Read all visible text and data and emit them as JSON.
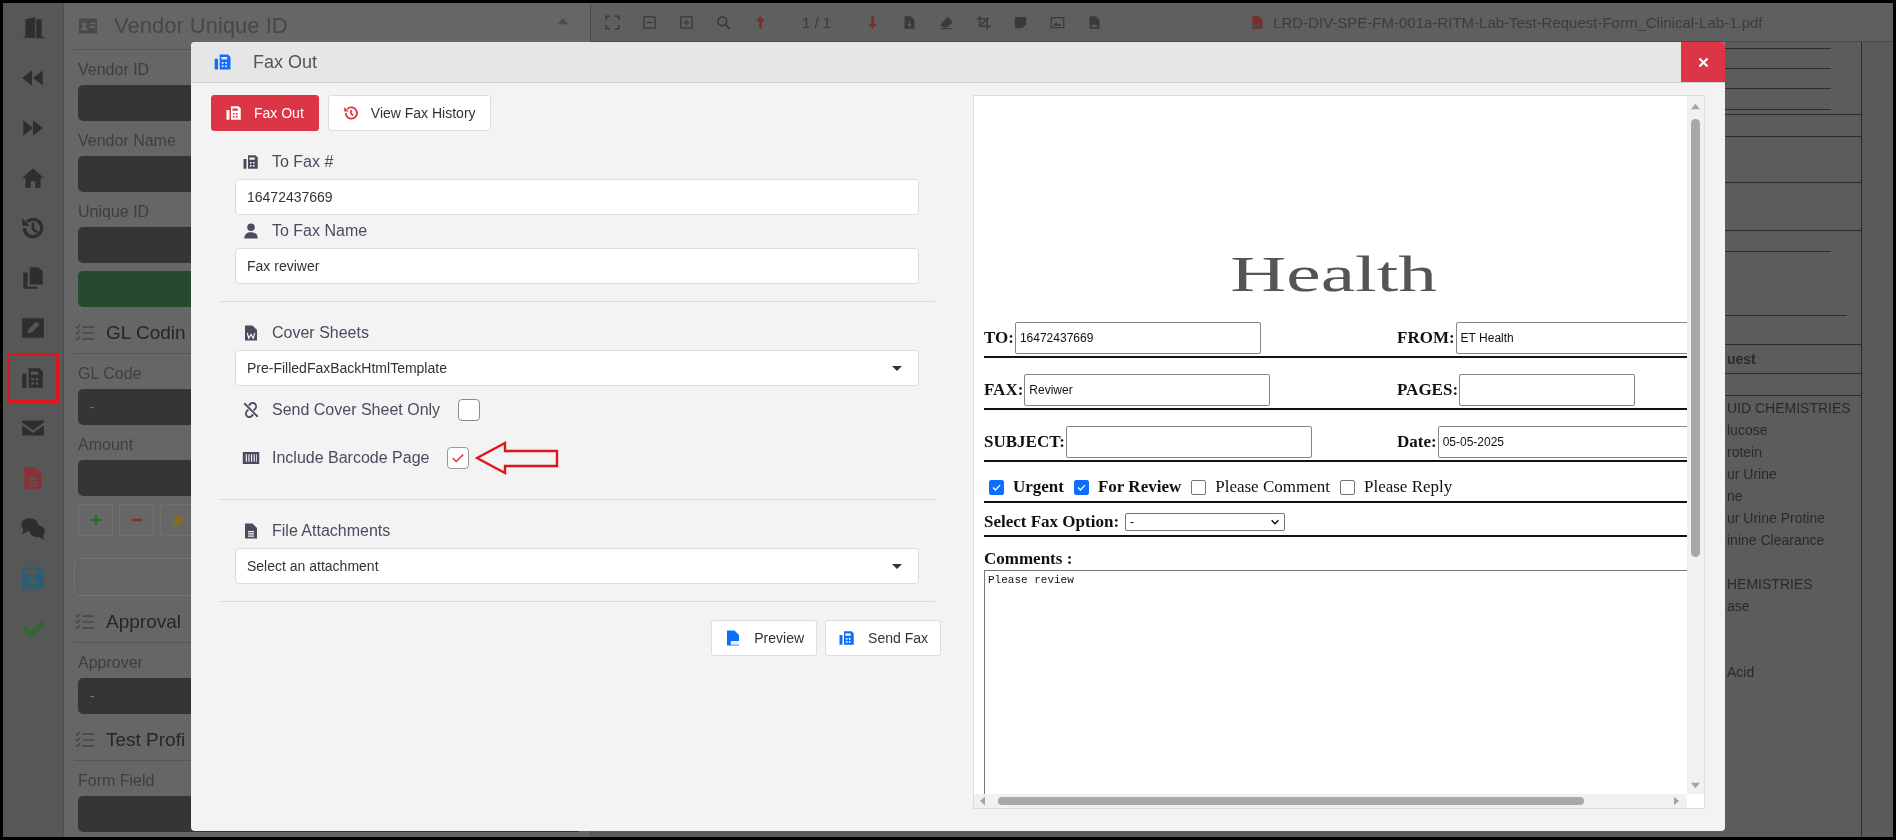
{
  "sidebar": {
    "items": [
      {
        "highlighted": false
      },
      {
        "highlighted": false
      },
      {
        "highlighted": false
      },
      {
        "highlighted": false
      },
      {
        "highlighted": false
      },
      {
        "highlighted": false
      },
      {
        "highlighted": false
      },
      {
        "highlighted": true
      },
      {
        "highlighted": false
      },
      {
        "highlighted": false
      },
      {
        "highlighted": false
      },
      {
        "highlighted": false
      },
      {
        "highlighted": false
      }
    ]
  },
  "form_panel": {
    "title": "Vendor Unique ID",
    "rows": [
      {
        "kind": "label",
        "text": "Vendor ID"
      },
      {
        "kind": "input"
      },
      {
        "kind": "label",
        "text": "Vendor Name"
      },
      {
        "kind": "input"
      },
      {
        "kind": "label",
        "text": "Unique ID"
      },
      {
        "kind": "input"
      },
      {
        "kind": "action"
      },
      {
        "kind": "section",
        "text": "GL Codin"
      },
      {
        "kind": "label",
        "text": "GL Code"
      },
      {
        "kind": "input",
        "value": "-"
      },
      {
        "kind": "label",
        "text": "Amount"
      },
      {
        "kind": "input"
      },
      {
        "kind": "tools"
      },
      {
        "kind": "field"
      },
      {
        "kind": "section",
        "text": "Approval"
      },
      {
        "kind": "label",
        "text": "Approver"
      },
      {
        "kind": "input",
        "value": "-"
      },
      {
        "kind": "section",
        "text": "Test Profi"
      },
      {
        "kind": "label",
        "text": "Form Field"
      },
      {
        "kind": "input"
      }
    ]
  },
  "viewer": {
    "page_indicator": "1 / 1",
    "file_name": "LRD-DIV-SPE-FM-001a-RITM-Lab-Test-Request-Form_Clinical-Lab-1.pdf",
    "document": {
      "heading": "uest",
      "groups": [
        [
          "UID CHEMISTRIES",
          "lucose",
          "rotein",
          "ur Urine",
          "ne",
          "ur Urine Protine",
          "inine Clearance"
        ],
        [
          "HEMISTRIES",
          "ase"
        ],
        [
          "Acid"
        ]
      ]
    }
  },
  "dialog": {
    "title": "Fax Out",
    "tabs": [
      {
        "label": "Fax Out",
        "selected": true
      },
      {
        "label": "View Fax History",
        "selected": false
      }
    ],
    "sections": [
      [
        {
          "kind": "text",
          "label": "To Fax #",
          "value": "16472437669"
        },
        {
          "kind": "text",
          "label": "To Fax Name",
          "value": "Fax reviwer"
        }
      ],
      [
        {
          "kind": "select",
          "label": "Cover Sheets",
          "value": "Pre-FilledFaxBackHtmlTemplate"
        },
        {
          "kind": "checkbox",
          "label": "Send Cover Sheet Only",
          "checked": false,
          "annotated": false
        },
        {
          "kind": "checkbox",
          "label": "Include Barcode Page",
          "checked": true,
          "annotated": true
        }
      ],
      [
        {
          "kind": "select",
          "label": "File Attachments",
          "value": "Select an attachment"
        }
      ]
    ],
    "buttons": [
      {
        "label": "Preview"
      },
      {
        "label": "Send Fax"
      }
    ],
    "preview": {
      "logo": "Health",
      "rows": [
        [
          {
            "label": "TO:",
            "value": "16472437669"
          },
          {
            "label": "FROM:",
            "value": "ET Health"
          }
        ],
        [
          {
            "label": "FAX:",
            "value": "Reviwer"
          },
          {
            "label": "PAGES:"
          }
        ],
        [
          {
            "label": "SUBJECT:"
          },
          {
            "label": "Date:",
            "value": "05-05-2025"
          }
        ]
      ],
      "options": [
        {
          "label": "Urgent",
          "checked": true
        },
        {
          "label": "For Review",
          "checked": true
        },
        {
          "label": "Please Comment",
          "checked": false
        },
        {
          "label": "Please Reply",
          "checked": false
        }
      ],
      "fax_option": {
        "label": "Select Fax Option:",
        "value": "-"
      },
      "comments": {
        "label": "Comments :",
        "value": "Please review"
      }
    }
  }
}
